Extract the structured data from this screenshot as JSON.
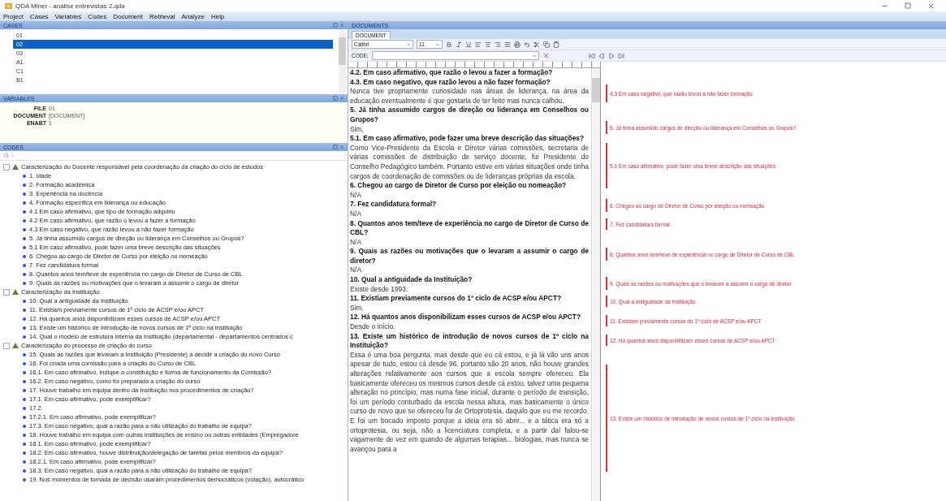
{
  "window": {
    "title": "QDA Miner - analise entrevistas 2.qda"
  },
  "menu": [
    "Project",
    "Cases",
    "Variables",
    "Codes",
    "Document",
    "Retrieval",
    "Analyze",
    "Help"
  ],
  "cases": {
    "title": "CASES",
    "items": [
      {
        "label": "01",
        "selected": false
      },
      {
        "label": "02",
        "selected": true
      },
      {
        "label": "03",
        "selected": false
      },
      {
        "label": "A1",
        "selected": false
      },
      {
        "label": "C1",
        "selected": false
      },
      {
        "label": "B1",
        "selected": false
      }
    ]
  },
  "variables": {
    "title": "VARIABLES",
    "items": [
      {
        "name": "FILE",
        "value": "01"
      },
      {
        "name": "DOCUMENT",
        "value": "[DOCUMENT]"
      },
      {
        "name": "ENABT",
        "value": "1"
      }
    ]
  },
  "codes": {
    "title": "CODES",
    "tree": [
      {
        "label": "Caracterização do Docente responsável pela coordenação da criação do ciclo de estudos",
        "expanded": true,
        "children": [
          {
            "label": "1. Idade"
          },
          {
            "label": "2. Formação académica"
          },
          {
            "label": "3. Experiência na docência"
          },
          {
            "label": "4. Formação específica em liderança ou educação"
          },
          {
            "label": "4.1 Em caso afirmativo, que tipo de formação adquiriu"
          },
          {
            "label": "4.2 Em caso afirmativo, que razão o levou a fazer a formação"
          },
          {
            "label": "4.3 Em caso negativo, que razão levou a não fazer formação"
          },
          {
            "label": "5. Já tinha assumido cargos de direção ou liderança em Conselhos ou Grupos?"
          },
          {
            "label": "5.1 Em caso afirmativo, pode fazer uma breve descrição das situações"
          },
          {
            "label": "6. Chegou ao cargo de Diretor de Curso por eleição ou nomeação"
          },
          {
            "label": "7. Fez candidatura formal"
          },
          {
            "label": "8. Quantos anos tem/teve de experiência no cargo de Diretor de Curso de CBL"
          },
          {
            "label": "9. Quais as razões ou motivações que o levaram a assumir o cargo de diretor"
          }
        ]
      },
      {
        "label": "Caracterização da Instituição",
        "expanded": true,
        "children": [
          {
            "label": "10. Qual a antiguidade da Instituição"
          },
          {
            "label": "11. Existiam previamente cursos de 1º ciclo de ACSP e/ou APCT"
          },
          {
            "label": "12. Há quantos anos disponibilizam esses cursos de ACSP e/ou APCT"
          },
          {
            "label": "13. Existe um histórico de introdução de novos cursos de 1º ciclo na Instituição"
          },
          {
            "label": "14. Qual o modelo de estrutura interna da Instituição (departamental - departamentos centrados c"
          }
        ]
      },
      {
        "label": "Caracterização do processo de criação do curso",
        "expanded": true,
        "children": [
          {
            "label": "15. Quais as razões que levaram a Instituição (Presidente) a decidir a criação do novo Curso"
          },
          {
            "label": "16. Foi criada uma comissão para a criação do Curso de CBL"
          },
          {
            "label": "16.1. Em caso afirmativo, indique a constituição e forma de funcionamento da Comissão?"
          },
          {
            "label": "16.2. Em caso negativo, como foi preparada a criação do curso"
          },
          {
            "label": "17. Houve trabalho em equipa dentro da Instituição nos procedimentos de criação?"
          },
          {
            "label": "17.1. Em caso afirmativo, pode exemplificar?"
          },
          {
            "label": "17.2."
          },
          {
            "label": "17.2.1. Em caso afirmativo, pode exemplificar?"
          },
          {
            "label": "17.3. Em caso negativo, qual a razão para a não utilização do trabalho de equipa?"
          },
          {
            "label": "18. Houve trabalho em equipa com outras Instituições de ensino ou outras entidades (Empregadore"
          },
          {
            "label": "18.1. Em caso afirmativo, pode exemplificar?"
          },
          {
            "label": "18.2. Em caso afirmativo, houve distribuição/delegação de tarefas pelos membros da equipa?"
          },
          {
            "label": "18.2.1. Em caso afirmativo, pode exemplificar?"
          },
          {
            "label": "18.3. Em caso negativo, qual a razão para a não utilização do trabalho de equipa?"
          },
          {
            "label": "19. Nos momentos de tomada de decisão usaram procedimentos democráticos (votação), autocrático"
          }
        ]
      }
    ]
  },
  "documents": {
    "title": "DOCUMENTS",
    "tabs": [
      {
        "label": "DOCUMENT",
        "selected": true
      }
    ],
    "font": "Calibri",
    "size": "11",
    "code_label": "CODE:",
    "blocks": [
      {
        "kind": "question",
        "text": "4.2. Em caso afirmativo, que razão o levou a fazer a formação?"
      },
      {
        "kind": "question",
        "text": "4.3. Em caso negativo, que razão levou a não fazer formação?"
      },
      {
        "kind": "answer",
        "text": "Nunca tive propriamente curiosidade nas áreas de liderança, na área da educação eventualmente é que gostaria de ter feito mas nunca calhou."
      },
      {
        "kind": "question",
        "text": "5. Já tinha assumido cargos de direção ou liderança em Conselhos ou Grupos?"
      },
      {
        "kind": "answer",
        "text": "Sim,"
      },
      {
        "kind": "question",
        "text": "5.1. Em caso afirmativo, pode fazer uma breve descrição das situações?"
      },
      {
        "kind": "answer",
        "text": "Como Vice-Presidente da Escola e Diretor várias comissões, secretaria de várias comissões de distribuição de serviço docente, fui Presidente do Conselho Pedagógico também. Portanto estive em várias situações onde tinha cargos de coordenação de comissões ou de lideranças próprias da escola."
      },
      {
        "kind": "question",
        "text": "6. Chegou ao cargo de Diretor de Curso por eleição ou nomeação?"
      },
      {
        "kind": "answer",
        "text": "N/A"
      },
      {
        "kind": "question",
        "text": "7. Fez candidatura formal?"
      },
      {
        "kind": "answer",
        "text": "N/A"
      },
      {
        "kind": "question",
        "text": "8. Quantos anos tem/teve de experiência no cargo de Diretor de Curso de CBL?"
      },
      {
        "kind": "answer",
        "text": "N/A"
      },
      {
        "kind": "question",
        "text": "9. Quais as razões ou motivações que o levaram a assumir o cargo de diretor?"
      },
      {
        "kind": "answer",
        "text": "N/A"
      },
      {
        "kind": "question",
        "text": "10. Qual a antiguidade da Instituição?"
      },
      {
        "kind": "answer",
        "text": "Existe desde 1993."
      },
      {
        "kind": "question",
        "text": "11. Existiam previamente cursos do 1º ciclo de ACSP e/ou APCT?"
      },
      {
        "kind": "answer",
        "text": "Sim."
      },
      {
        "kind": "question",
        "text": "12. Há quantos anos disponibilizam esses cursos de ACSP e/ou APCT?"
      },
      {
        "kind": "answer",
        "text": "Desde o início."
      },
      {
        "kind": "question",
        "text": "13. Existe um histórico de introdução de novos cursos de 1º ciclo na Instituição?"
      },
      {
        "kind": "answer",
        "text": "Essa é uma boa pergunta, mas desde que eu cá estou, e já lá vão uns anos apesar de tudo, estou cá desde 96, portanto são 20 anos, não houve grandes alterações relativamente aos cursos que a escola sempre ofereceu. Ela basicamente ofereceu os mesmos cursos desde cá estou, talvez uma pequena alteração no princípio, mas numa fase inicial, durante o período de transição, foi um período conturbado da escola nessa altura, mas basicamente o único curso de novo que se ofereceu foi de Ortoprotesia, daquilo que eu me recordo. E foi um bocado imposto porque a ideia era só abrir... e a tática era só a ortoprotesia, ou seja, não a licenciatura completa, e a partir daí falou-se vagamente de vez em quando de algumas terapias... biologias, mas nunca se avançou para a"
      }
    ],
    "annotations": [
      {
        "text": "4.3 Em caso negativo, que razão levou a não fazer formação"
      },
      {
        "text": "5. Já tinha assumido cargos de direção ou liderança em Conselhos ou Grupos?"
      },
      {
        "text": "5.1 Em caso afirmativo, pode fazer uma breve descrição das situações"
      },
      {
        "text": "6. Chegou ao cargo de Diretor de Curso por eleição ou nomeação"
      },
      {
        "text": "7. Fez candidatura formal"
      },
      {
        "text": "8. Quantos anos tem/teve de experiência no cargo de Diretor de Curso de CBL"
      },
      {
        "text": "9. Quais as razões ou motivações que o levaram a assumir o cargo de diretor"
      },
      {
        "text": "10. Qual a antiguidade da Instituição"
      },
      {
        "text": "11. Existiam previamente cursos do 1º ciclo de ACSP e/ou APCT"
      },
      {
        "text": "12. Há quantos anos disponibilizam esses cursos de ACSP e/ou APCT"
      },
      {
        "text": "13. Existe um histórico de introdução de novos cursos de 1º ciclo na Instituição"
      }
    ]
  }
}
